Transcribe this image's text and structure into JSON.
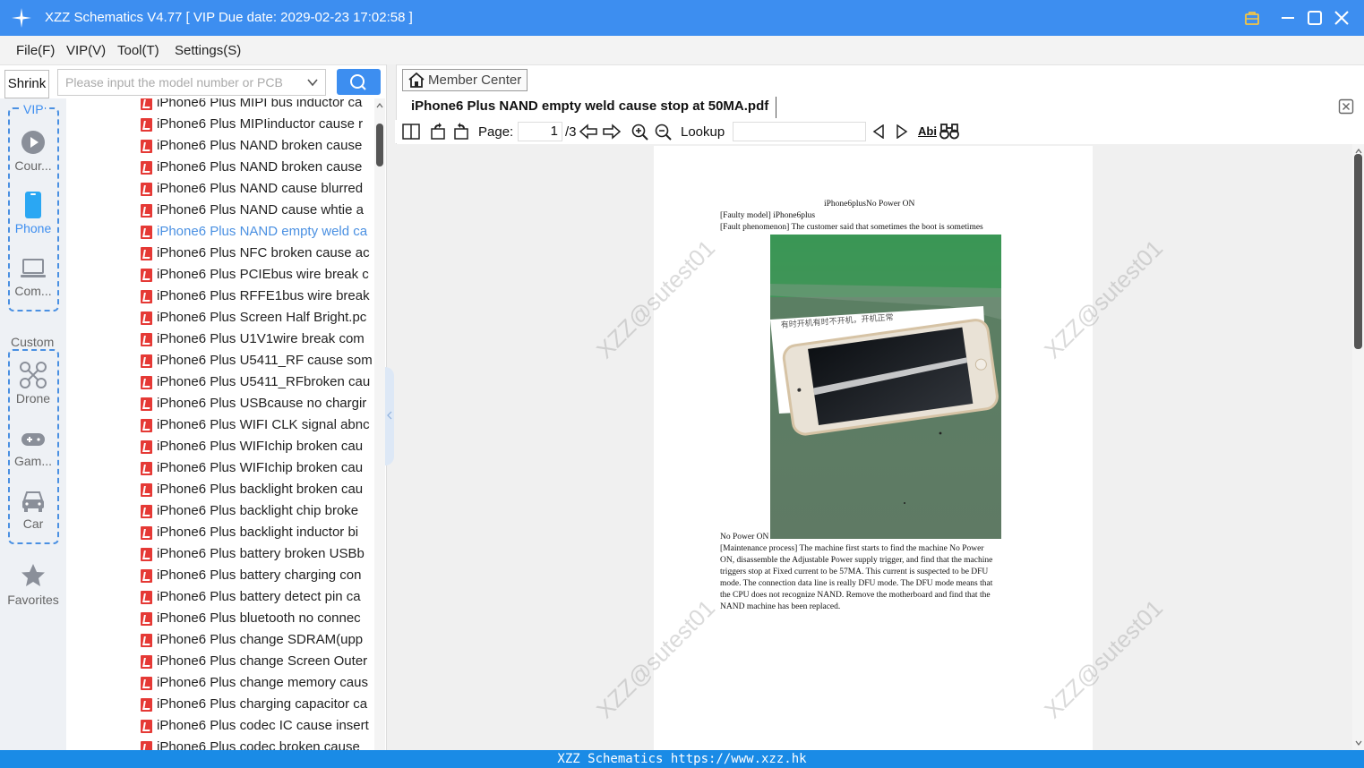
{
  "window": {
    "title": "XZZ Schematics V4.77 [ VIP Due date: 2029-02-23 17:02:58 ]"
  },
  "menu": [
    "File(F)",
    "VIP(V)",
    "Tool(T)",
    "Settings(S)"
  ],
  "search": {
    "shrink_label": "Shrink",
    "placeholder": "Please input the model number or PCB"
  },
  "nav": {
    "vip_title": "VIP",
    "vip_items": [
      "Cour...",
      "Phone",
      "Com..."
    ],
    "custom_title": "Custom",
    "custom_items": [
      "Drone",
      "Gam...",
      "Car"
    ],
    "favorites": "Favorites",
    "active": "Phone"
  },
  "files": [
    "iPhone6 Plus MIPI bus inductor ca",
    "iPhone6 Plus MIPIinductor cause r",
    "iPhone6 Plus NAND broken cause",
    "iPhone6 Plus NAND broken cause",
    "iPhone6 Plus NAND cause blurred",
    "iPhone6 Plus NAND cause whtie a",
    "iPhone6 Plus NAND empty weld ca",
    "iPhone6 Plus NFC broken cause ac",
    "iPhone6 Plus PCIEbus wire break  c",
    "iPhone6 Plus RFFE1bus wire break",
    "iPhone6 Plus Screen Half Bright.pc",
    "iPhone6 Plus U1V1wire break  com",
    "iPhone6 Plus U5411_RF cause som",
    "iPhone6 Plus U5411_RFbroken cau",
    "iPhone6 Plus USBcause no chargir",
    "iPhone6 Plus WIFI CLK signal abnc",
    "iPhone6 Plus WIFIchip broken cau",
    "iPhone6 Plus WIFIchip broken cau",
    "iPhone6 Plus backlight broken cau",
    "iPhone6 Plus backlight chip broke",
    "iPhone6 Plus backlight inductor bi",
    "iPhone6 Plus battery broken USBb",
    "iPhone6 Plus battery charging con",
    "iPhone6 Plus battery detect pin ca",
    "iPhone6 Plus bluetooth no connec",
    "iPhone6 Plus change SDRAM(upp",
    "iPhone6 Plus change Screen Outer",
    "iPhone6 Plus change memory caus",
    "iPhone6 Plus charging capacitor ca",
    "iPhone6 Plus codec IC cause insert",
    "iPhone6 Plus codec broken cause"
  ],
  "active_file_index": 6,
  "viewer": {
    "member_center": "Member Center",
    "doc_title": "iPhone6 Plus NAND empty weld cause stop at 50MA.pdf",
    "page_label": "Page:",
    "page_current": "1",
    "page_total": "/3",
    "lookup_label": "Lookup",
    "lookup_value": "",
    "abi_label": "Abi"
  },
  "document": {
    "heading": "iPhone6plusNo Power ON",
    "faulty_model": "[Faulty model] iPhone6plus",
    "fault_phenomenon": "[Fault phenomenon] The customer said that sometimes the boot is sometimes",
    "no_power": "No Power ON",
    "maintenance_lines": [
      "[Maintenance process] The machine first starts to find the machine No Power",
      "ON, disassemble the Adjustable Power supply trigger, and find that the machine",
      "triggers stop at Fixed current to be 57MA. This current is suspected to be DFU",
      "mode. The connection data line is really DFU mode. The DFU mode means that",
      "the CPU does not recognize NAND. Remove the motherboard and find that the",
      "NAND machine has been replaced."
    ],
    "photo_caption": "有时开机有时不开机，开机正常",
    "watermark": "XZZ@sutest01"
  },
  "status": "XZZ Schematics https://www.xzz.hk",
  "colors": {
    "accent": "#3d8ef0",
    "status_bar": "#1a8be6",
    "pdf_icon": "#e53935"
  }
}
